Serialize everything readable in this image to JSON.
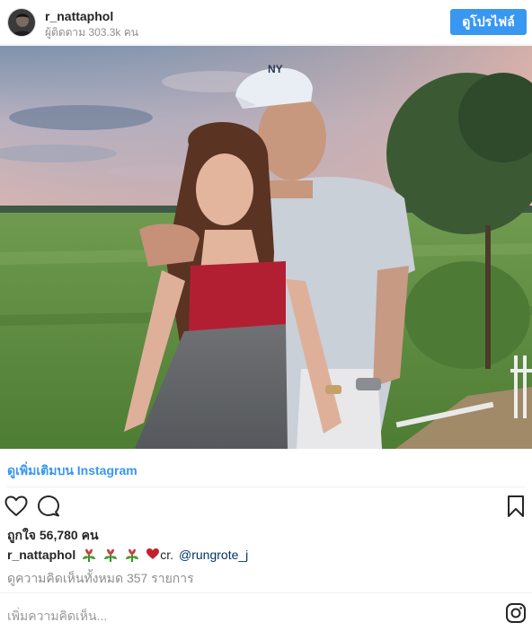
{
  "header": {
    "username": "r_nattaphol",
    "followers": "ผู้ติดตาม 303.3k คน",
    "profile_button": "ดูโปรไฟล์"
  },
  "post": {
    "more_link": "ดูเพิ่มเติมบน Instagram",
    "likes": "ถูกใจ 56,780 คน",
    "caption_user": "r_nattaphol",
    "caption_cr": "cr.",
    "caption_mention": "@rungrote_j",
    "comments_link": "ดูความคิดเห็นทั้งหมด 357 รายการ",
    "add_comment_placeholder": "เพิ่มความคิดเห็น..."
  },
  "icons": {
    "like": "heart-icon",
    "comment": "comment-bubble-icon",
    "save": "bookmark-icon",
    "brand": "instagram-icon",
    "caption_emoji": [
      "flower-emoji",
      "flower-emoji",
      "flower-emoji",
      "heart-emoji"
    ]
  },
  "colors": {
    "accent": "#3897f0",
    "mention": "#003569",
    "muted": "#8e8e8e"
  }
}
